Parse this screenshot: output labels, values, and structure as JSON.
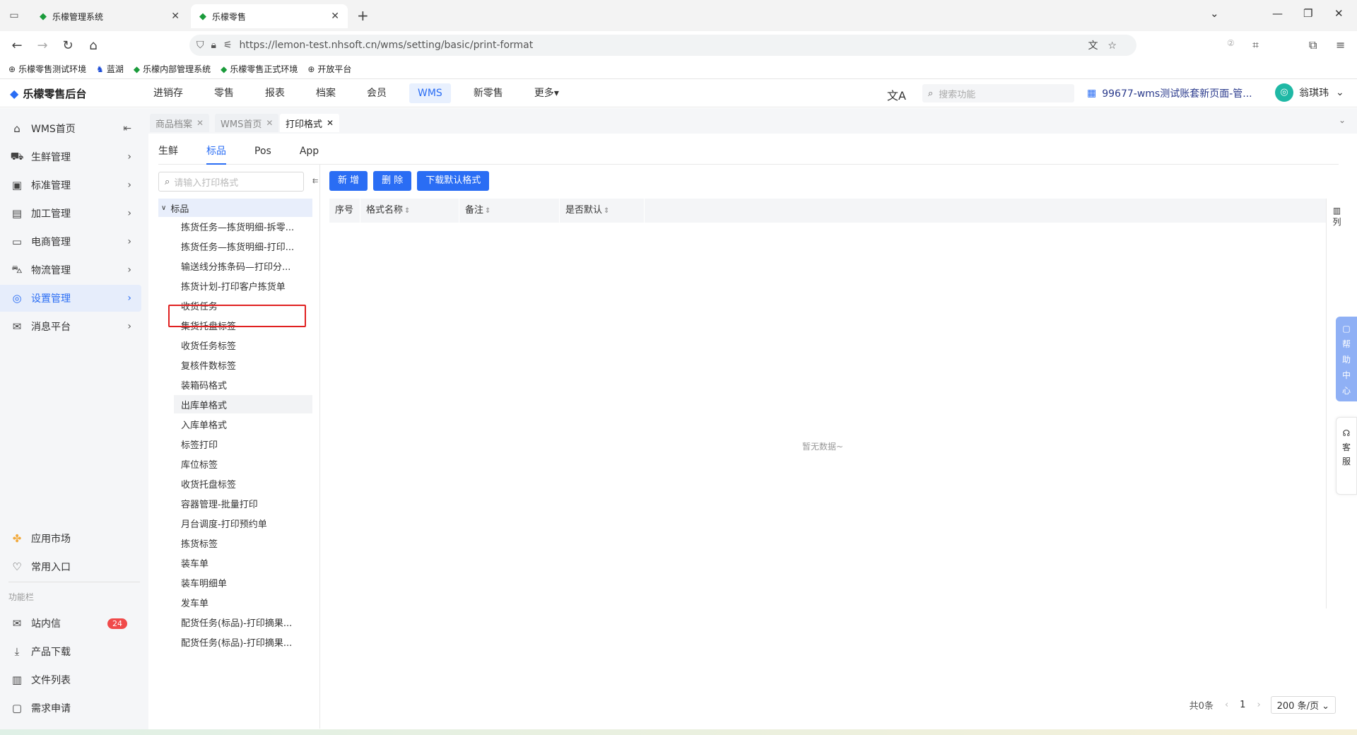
{
  "browser": {
    "tabs": [
      {
        "title": "乐檬管理系统"
      },
      {
        "title": "乐檬零售"
      }
    ],
    "url": "https://lemon-test.nhsoft.cn/wms/setting/basic/print-format",
    "bookmarks": [
      "乐檬零售测试环境",
      "蓝湖",
      "乐檬内部管理系统",
      "乐檬零售正式环境",
      "开放平台"
    ]
  },
  "app": {
    "logo": "乐檬零售后台",
    "topnav": [
      "进销存",
      "零售",
      "报表",
      "档案",
      "会员",
      "WMS",
      "新零售",
      "更多"
    ],
    "active_nav": "WMS",
    "search_placeholder": "搜索功能",
    "account": "99677-wms测试账套新页面-管...",
    "user": "翁琪玮"
  },
  "sidebar": {
    "items": [
      {
        "label": "WMS首页",
        "icon": "home-icon"
      },
      {
        "label": "生鲜管理",
        "icon": "fresh-icon"
      },
      {
        "label": "标准管理",
        "icon": "standard-icon"
      },
      {
        "label": "加工管理",
        "icon": "process-icon"
      },
      {
        "label": "电商管理",
        "icon": "shop-icon"
      },
      {
        "label": "物流管理",
        "icon": "truck-icon"
      },
      {
        "label": "设置管理",
        "icon": "settings-icon"
      },
      {
        "label": "消息平台",
        "icon": "message-icon"
      }
    ],
    "bottom": [
      {
        "label": "应用市场",
        "icon": "app-market-icon"
      },
      {
        "label": "常用入口",
        "icon": "heart-icon"
      }
    ],
    "section_label": "功能栏",
    "tools": [
      {
        "label": "站内信",
        "icon": "mail-icon",
        "badge": "24"
      },
      {
        "label": "产品下载",
        "icon": "download-icon"
      },
      {
        "label": "文件列表",
        "icon": "chart-icon"
      },
      {
        "label": "需求申请",
        "icon": "chat-icon"
      }
    ]
  },
  "page_tabs": [
    "商品档案",
    "WMS首页",
    "打印格式"
  ],
  "sub_tabs": [
    "生鲜",
    "标品",
    "Pos",
    "App"
  ],
  "tree": {
    "search_placeholder": "请输入打印格式",
    "root": "标品",
    "nodes": [
      "拣货任务—拣货明细-拆零...",
      "拣货任务—拣货明细-打印...",
      "输送线分拣条码—打印分...",
      "拣货计划-打印客户拣货单",
      "收货任务",
      "集货托盘标签",
      "收货任务标签",
      "复核件数标签",
      "装箱码格式",
      "出库单格式",
      "入库单格式",
      "标签打印",
      "库位标签",
      "收货托盘标签",
      "容器管理-批量打印",
      "月台调度-打印预约单",
      "拣货标签",
      "装车单",
      "装车明细单",
      "发车单",
      "配货任务(标品)-打印摘果...",
      "配货任务(标品)-打印摘果..."
    ]
  },
  "buttons": [
    "新 增",
    "删 除",
    "下载默认格式"
  ],
  "table": {
    "columns": [
      "序号",
      "格式名称",
      "备注",
      "是否默认"
    ],
    "empty_text": "暂无数据~",
    "col_setting": "列"
  },
  "pager": {
    "total": "共0条",
    "page": "1",
    "page_size": "200 条/页"
  },
  "float": {
    "help": "帮助中心",
    "service": "客服"
  }
}
